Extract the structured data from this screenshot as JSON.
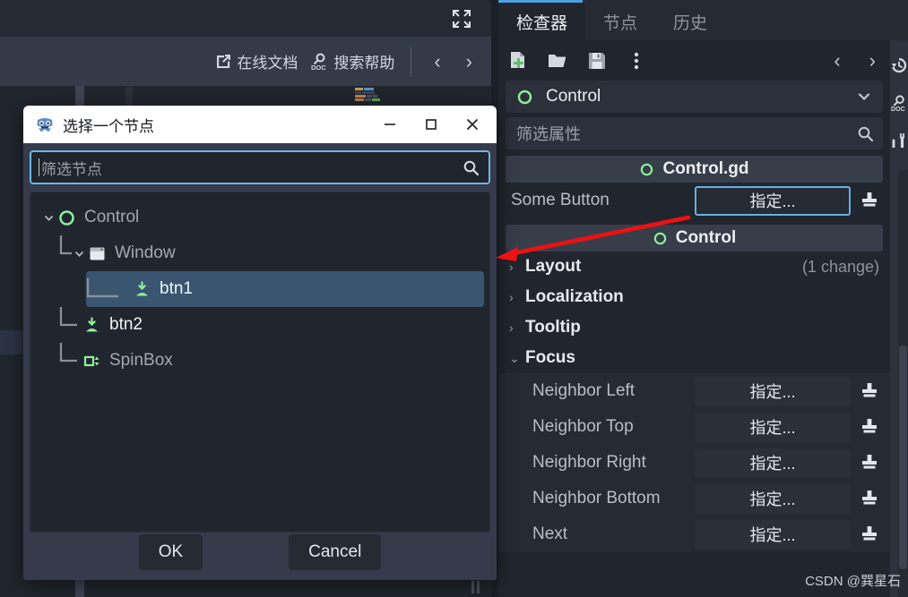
{
  "editor": {
    "toolbar": {
      "expand_icon": "expand-arrows-icon"
    },
    "menu": {
      "online_docs": "在线文档",
      "search_help": "搜索帮助",
      "prev_label": "‹",
      "next_label": "›"
    }
  },
  "dialog": {
    "title": "选择一个节点",
    "app_icon": "godot-robot-icon",
    "minimize_label": "—",
    "maximize_label": "□",
    "close_label": "✕",
    "filter": {
      "placeholder": "筛选节点",
      "value": "",
      "search_icon": "search-icon"
    },
    "tree": [
      {
        "label": "Control",
        "icon": "control-node-icon",
        "depth": 0,
        "selected": false,
        "expanded": true,
        "has_caret": true
      },
      {
        "label": "Window",
        "icon": "window-node-icon",
        "depth": 1,
        "selected": false,
        "expanded": true,
        "has_caret": true
      },
      {
        "label": "btn1",
        "icon": "button-node-icon",
        "depth": 2,
        "selected": true,
        "expanded": false,
        "has_caret": false
      },
      {
        "label": "btn2",
        "icon": "button-node-icon",
        "depth": 1,
        "selected": false,
        "expanded": false,
        "has_caret": false
      },
      {
        "label": "SpinBox",
        "icon": "spinbox-node-icon",
        "depth": 1,
        "selected": false,
        "expanded": false,
        "has_caret": false
      }
    ],
    "ok_label": "OK",
    "cancel_label": "Cancel"
  },
  "inspector": {
    "tabs": [
      {
        "label": "检查器",
        "active": true
      },
      {
        "label": "节点",
        "active": false
      },
      {
        "label": "历史",
        "active": false
      }
    ],
    "toolbar_icons": [
      "new-resource-icon",
      "open-resource-icon",
      "save-resource-icon",
      "more-options-icon"
    ],
    "nav_prev": "‹",
    "nav_next": "›",
    "object": {
      "name": "Control",
      "icon": "control-node-icon",
      "dropdown_icon": "chevron-down-icon"
    },
    "property_search": {
      "placeholder": "筛选属性",
      "value": "",
      "search_icon": "search-icon"
    },
    "script_section": {
      "title": "Control.gd",
      "icon": "script-icon"
    },
    "script_property": {
      "name": "Some Button",
      "value": "指定...",
      "focused": true,
      "clear_icon": "revert-icon"
    },
    "class_section": {
      "title": "Control",
      "icon": "control-node-icon"
    },
    "categories": [
      {
        "name": "Layout",
        "expanded": false,
        "note": "(1 change)"
      },
      {
        "name": "Localization",
        "expanded": false,
        "note": ""
      },
      {
        "name": "Tooltip",
        "expanded": false,
        "note": ""
      },
      {
        "name": "Focus",
        "expanded": true,
        "note": ""
      }
    ],
    "focus_properties": [
      {
        "name": "Neighbor Left",
        "value": "指定...",
        "clear_icon": "revert-icon"
      },
      {
        "name": "Neighbor Top",
        "value": "指定...",
        "clear_icon": "revert-icon"
      },
      {
        "name": "Neighbor Right",
        "value": "指定...",
        "clear_icon": "revert-icon"
      },
      {
        "name": "Neighbor Bottom",
        "value": "指定...",
        "clear_icon": "revert-icon"
      },
      {
        "name": "Next",
        "value": "指定...",
        "clear_icon": "revert-icon"
      }
    ],
    "side_icons": [
      "history-icon",
      "doc-search-icon",
      "editor-settings-icon"
    ]
  },
  "annotation": {
    "arrow_color": "#ee1111"
  },
  "watermark": "CSDN @巽星石",
  "colors": {
    "accent_blue": "#4e9fe0",
    "focus_blue": "#64b0e6",
    "node_green": "#8ef09a",
    "panel_dark": "#21262e",
    "dialog_body": "#353b4a",
    "selection": "#3a556f"
  }
}
